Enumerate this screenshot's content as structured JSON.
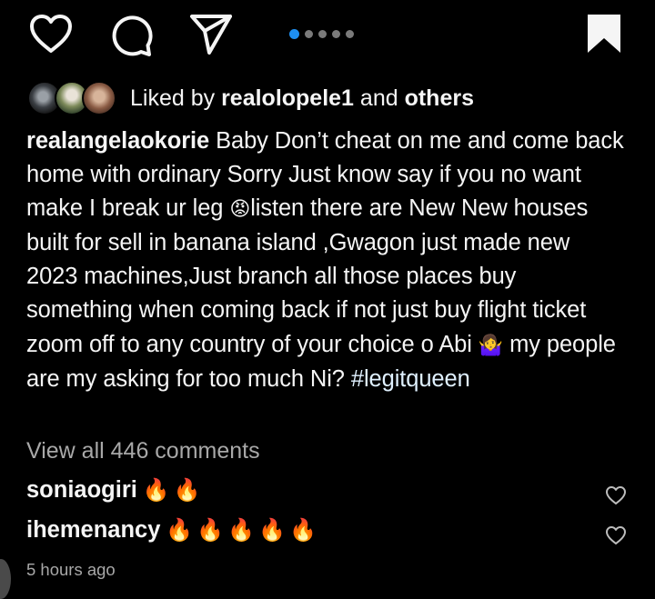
{
  "colors": {
    "background": "#000000",
    "text": "#f5f5f5",
    "muted": "#a8a8a8",
    "carousel_active": "#1e8ff1",
    "carousel_inactive": "#7a7a7a",
    "fire": "#ff8a1e"
  },
  "action_bar": {
    "icons": [
      "heart-outline-icon",
      "comment-bubble-icon",
      "paper-plane-share-icon",
      "bookmark-filled-icon"
    ],
    "carousel": {
      "total": 5,
      "active_index": 0
    }
  },
  "likes": {
    "prefix": "Liked by ",
    "username": "realolopele1",
    "middle": " and ",
    "others": "others"
  },
  "caption": {
    "username": "realangelaokorie",
    "text_part1": " Baby Don’t cheat on me and come back home with ordinary Sorry Just know say if you no want make I break ur leg ",
    "emoji_angry": "😡",
    "text_part2": "listen there are New New houses built for sell in banana island ,Gwagon just made new 2023 machines,Just branch all those places buy something when coming back if not just buy flight ticket zoom off to any country of your choice o Abi ",
    "emoji_shrug": "🤷‍♀️",
    "text_part3": " my people are my asking for too much Ni? ",
    "hashtag": "#legitqueen"
  },
  "view_comments": "View all 446 comments",
  "comments": [
    {
      "username": "soniaogiri",
      "emojis": "🔥🔥"
    },
    {
      "username": "ihemenancy",
      "emojis": "🔥🔥🔥🔥🔥"
    }
  ],
  "timestamp": "5 hours ago"
}
